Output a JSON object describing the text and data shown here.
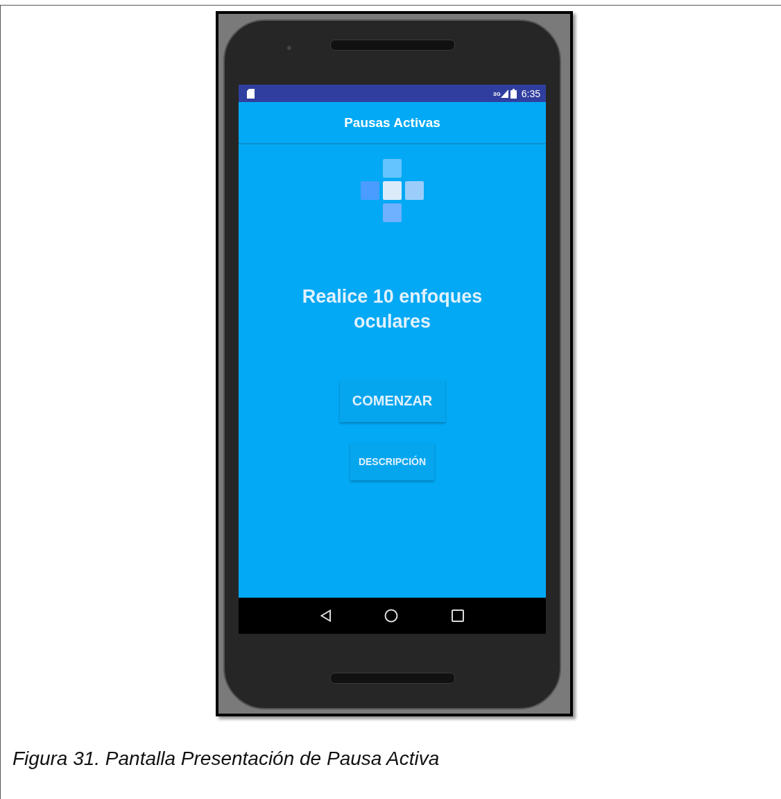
{
  "status_bar": {
    "network": "3G",
    "time": "6:35"
  },
  "app_bar": {
    "title": "Pausas Activas"
  },
  "message": "Realice 10 enfoques oculares",
  "buttons": [
    {
      "label": "COMENZAR",
      "kind": "primary"
    },
    {
      "label": "DESCRIPCIÓN",
      "kind": "secondary"
    }
  ],
  "caption": "Figura 31. Pantalla Presentación de Pausa Activa"
}
